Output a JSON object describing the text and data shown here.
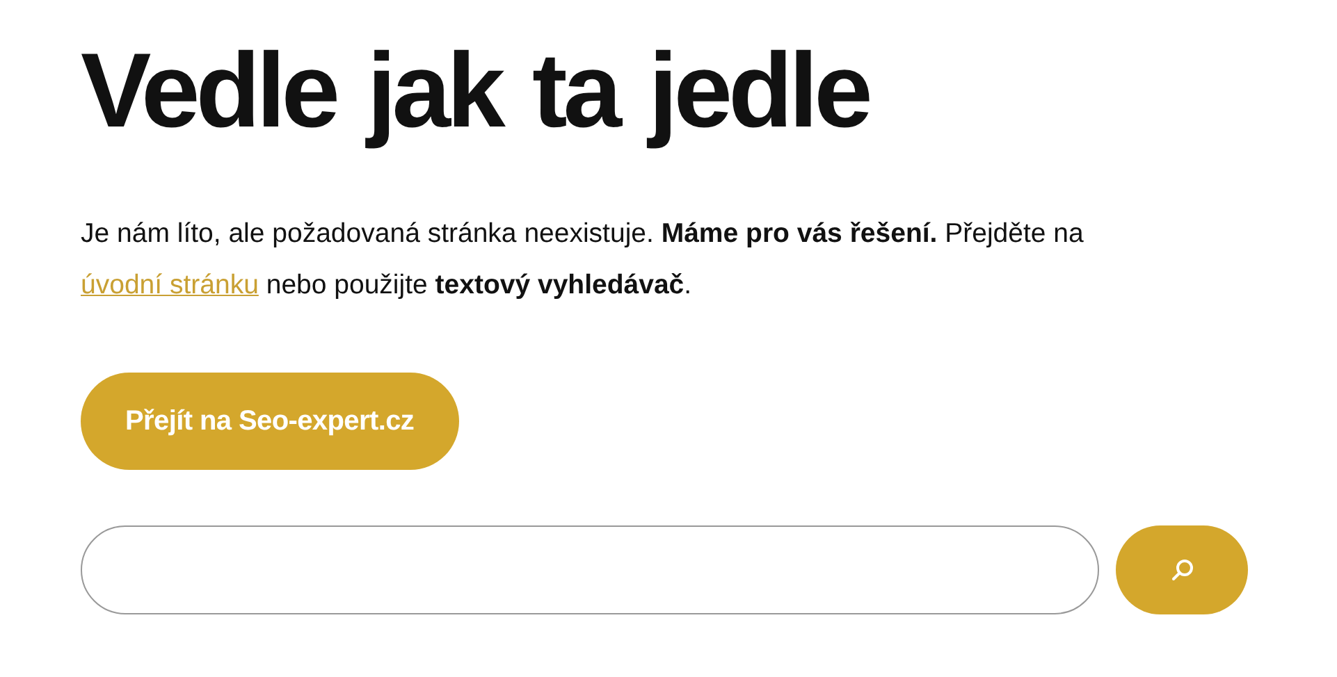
{
  "heading": "Vedle jak ta jedle",
  "message": {
    "before": "Je nám líto, ale požadovaná stránka neexistuje. **Máme pro vás řešení.** Přejděte na",
    "link": "úvodní stránku",
    "after": "nebo použijte **textový vyhledávač**."
  },
  "home_button": "Přejít na Seo-expert.cz"
}
